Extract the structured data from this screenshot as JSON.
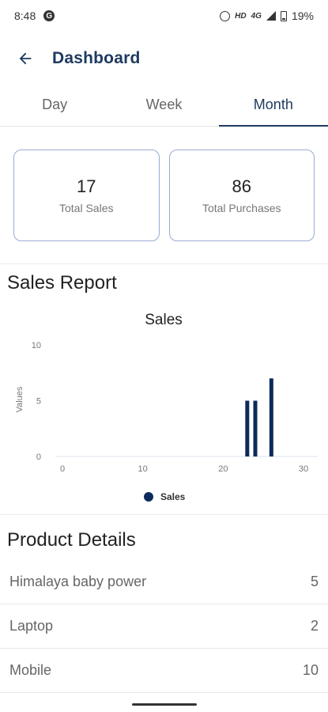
{
  "status_bar": {
    "time": "8:48",
    "network": "HD",
    "signal_label": "4G",
    "battery": "19%"
  },
  "app_bar": {
    "title": "Dashboard",
    "back_icon": "arrow-back-icon"
  },
  "tabs": [
    {
      "label": "Day",
      "active": false
    },
    {
      "label": "Week",
      "active": false
    },
    {
      "label": "Month",
      "active": true
    }
  ],
  "summary": {
    "sales_value": "17",
    "sales_label": "Total Sales",
    "purchases_value": "86",
    "purchases_label": "Total Purchases"
  },
  "sales_report": {
    "heading": "Sales Report"
  },
  "chart_data": {
    "type": "bar",
    "title": "Sales",
    "xlabel": "",
    "ylabel": "Values",
    "xlim": [
      0,
      30
    ],
    "ylim": [
      0,
      10
    ],
    "x_ticks": [
      "0",
      "10",
      "20",
      "30"
    ],
    "y_ticks": [
      "0",
      "5",
      "10"
    ],
    "series": [
      {
        "name": "Sales",
        "x": [
          23,
          24,
          26
        ],
        "values": [
          5,
          5,
          7
        ]
      }
    ],
    "legend": "bottom-center",
    "grid": false,
    "bar_color": "#0d2a5c"
  },
  "product_details": {
    "heading": "Product Details",
    "items": [
      {
        "name": "Himalaya baby power",
        "qty": "5"
      },
      {
        "name": "Laptop",
        "qty": "2"
      },
      {
        "name": "Mobile",
        "qty": "10"
      }
    ]
  },
  "colors": {
    "accent": "#1e3a5f",
    "card_border": "#9aa9d6",
    "bar": "#0d2a5c"
  }
}
